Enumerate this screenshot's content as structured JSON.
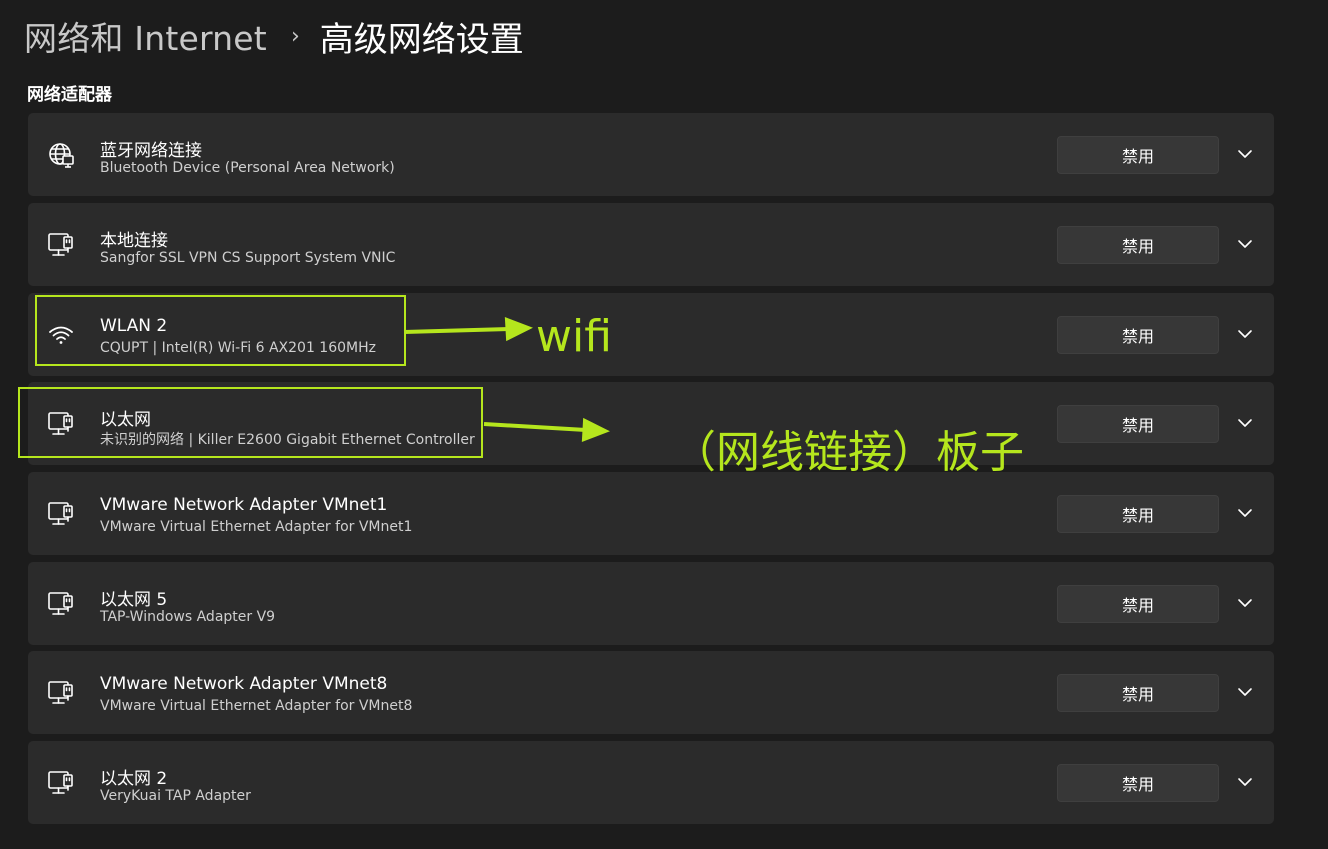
{
  "breadcrumb": {
    "parent": "网络和 Internet",
    "separator": "›",
    "current": "高级网络设置"
  },
  "section_title": "网络适配器",
  "adapters": [
    {
      "name": "蓝牙网络连接",
      "description": "Bluetooth Device (Personal Area Network)",
      "icon": "globe-network-icon",
      "button": "禁用"
    },
    {
      "name": "本地连接",
      "description": "Sangfor SSL VPN CS Support System VNIC",
      "icon": "ethernet-icon",
      "button": "禁用"
    },
    {
      "name": "WLAN 2",
      "description": "CQUPT | Intel(R) Wi-Fi 6 AX201 160MHz",
      "icon": "wifi-icon",
      "button": "禁用"
    },
    {
      "name": "以太网",
      "description": "未识别的网络 | Killer E2600 Gigabit Ethernet Controller",
      "icon": "ethernet-icon",
      "button": "禁用"
    },
    {
      "name": "VMware Network Adapter VMnet1",
      "description": "VMware Virtual Ethernet Adapter for VMnet1",
      "icon": "ethernet-icon",
      "button": "禁用"
    },
    {
      "name": "以太网 5",
      "description": "TAP-Windows Adapter V9",
      "icon": "ethernet-icon",
      "button": "禁用"
    },
    {
      "name": "VMware Network Adapter VMnet8",
      "description": "VMware Virtual Ethernet Adapter for VMnet8",
      "icon": "ethernet-icon",
      "button": "禁用"
    },
    {
      "name": "以太网 2",
      "description": "VeryKuai TAP Adapter",
      "icon": "ethernet-icon",
      "button": "禁用"
    }
  ],
  "annotations": {
    "wifi_label": "wifi",
    "ethernet_label": "（网线链接）板子",
    "color": "#b5e61d"
  },
  "colors": {
    "background": "#1c1c1c",
    "card": "#2b2b2b",
    "button": "#373737"
  }
}
